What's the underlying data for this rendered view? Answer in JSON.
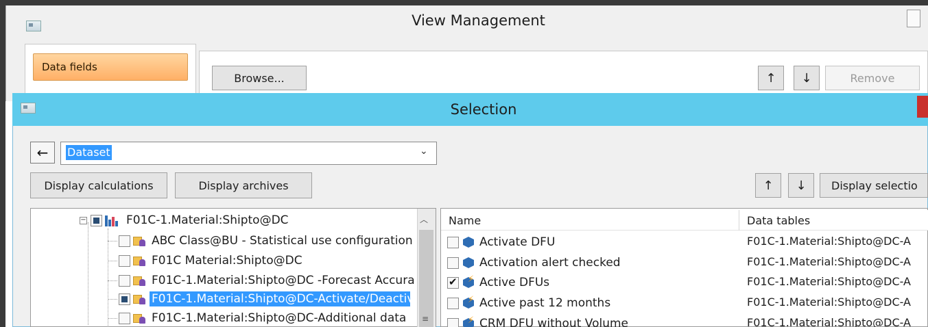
{
  "view_management": {
    "title": "View Management",
    "sidebar_item": "Data fields",
    "browse_label": "Browse...",
    "up_label": "↑",
    "down_label": "↓",
    "remove_label": "Remove"
  },
  "selection": {
    "title": "Selection",
    "back_label": "←",
    "combo_value": "Dataset",
    "combo_arrow": "⌄",
    "display_calculations_label": "Display calculations",
    "display_archives_label": "Display archives",
    "up_label": "↑",
    "down_label": "↓",
    "display_selection_label": "Display selectio",
    "tree": {
      "root": {
        "label": "F01C-1.Material:Shipto@DC",
        "expander": "−"
      },
      "items": [
        {
          "label": "ABC Class@BU - Statistical use configuration",
          "selected": false
        },
        {
          "label": "F01C Material:Shipto@DC",
          "selected": false
        },
        {
          "label": "F01C-1.Material:Shipto@DC -Forecast Accura",
          "selected": false
        },
        {
          "label": "F01C-1.Material:Shipto@DC-Activate/Deactiv",
          "selected": true
        },
        {
          "label": "F01C-1.Material:Shipto@DC-Additional data",
          "selected": false
        }
      ]
    },
    "list": {
      "col_name": "Name",
      "col_data_tables": "Data tables",
      "rows": [
        {
          "name": "Activate DFU",
          "data_table": "F01C-1.Material:Shipto@DC-A",
          "checked": false,
          "icon": "cube-icon"
        },
        {
          "name": "Activation alert checked",
          "data_table": "F01C-1.Material:Shipto@DC-A",
          "checked": false,
          "icon": "cube-icon"
        },
        {
          "name": "Active DFUs",
          "data_table": "F01C-1.Material:Shipto@DC-A",
          "checked": true,
          "icon": "calculated-cube-icon"
        },
        {
          "name": "Active past 12 months",
          "data_table": "F01C-1.Material:Shipto@DC-A",
          "checked": false,
          "icon": "calculated-cube-icon"
        },
        {
          "name": "CRM DFU without Volume",
          "data_table": "F01C-1.Material:Shipto@DC-A",
          "checked": false,
          "icon": "calculated-cube-icon"
        }
      ]
    }
  },
  "colors": {
    "selection_titlebar": "#5ecbec",
    "highlight": "#3399ff",
    "data_fields_accent": "#ffb066"
  }
}
